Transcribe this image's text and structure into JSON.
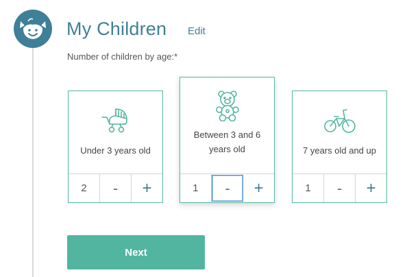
{
  "section": {
    "title": "My Children",
    "edit_label": "Edit",
    "subtitle": "Number of children by age:*"
  },
  "cards": [
    {
      "label": "Under 3 years old",
      "icon": "stroller-icon",
      "count": "2",
      "minus": "-",
      "plus": "+"
    },
    {
      "label": "Between 3 and 6 years old",
      "icon": "teddy-bear-icon",
      "count": "1",
      "minus": "-",
      "plus": "+"
    },
    {
      "label": "7 years old and up",
      "icon": "bicycle-icon",
      "count": "1",
      "minus": "-",
      "plus": "+"
    }
  ],
  "next_label": "Next",
  "colors": {
    "brand_blue": "#3f7f97",
    "accent_green": "#52b5a0",
    "focus_blue": "#4a90d9"
  }
}
